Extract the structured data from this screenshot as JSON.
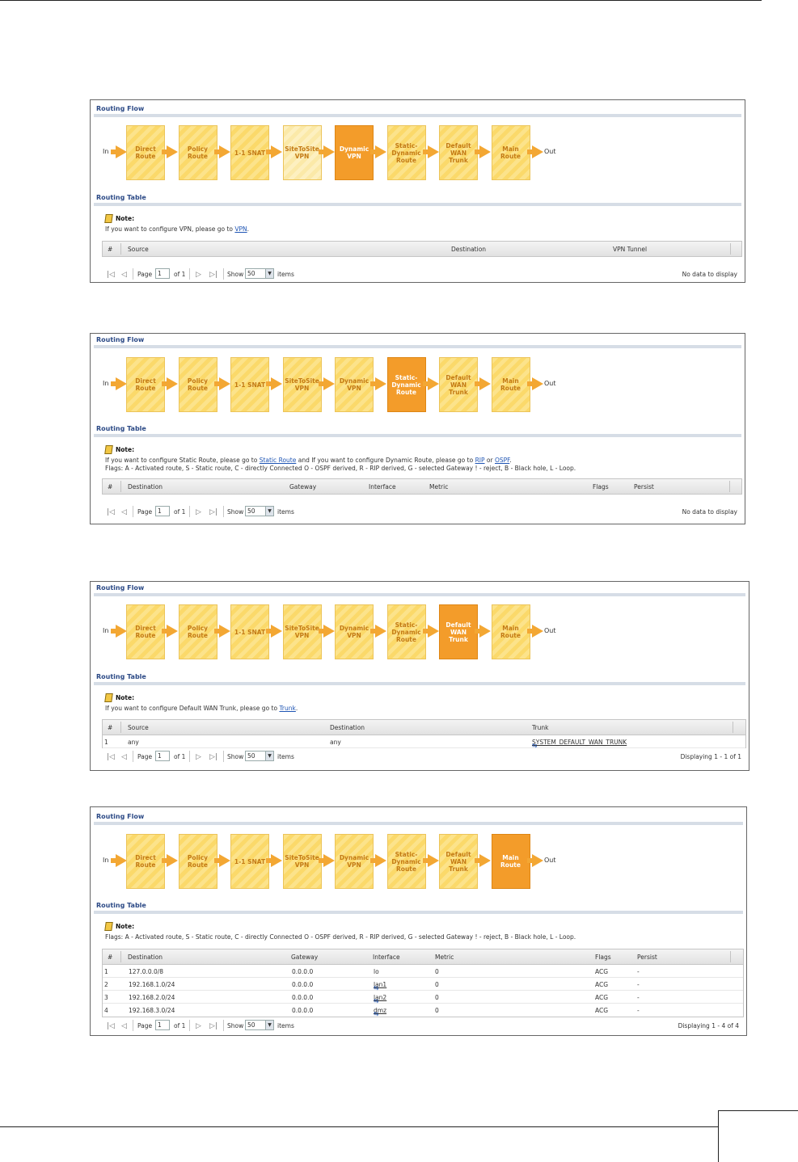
{
  "flow": {
    "title": "Routing Flow",
    "in_label": "In",
    "out_label": "Out",
    "steps": [
      "Direct\nRoute",
      "Policy\nRoute",
      "1-1 SNAT",
      "SiteToSite\nVPN",
      "Dynamic\nVPN",
      "Static-\nDynamic\nRoute",
      "Default\nWAN\nTrunk",
      "Main\nRoute"
    ]
  },
  "table_title": "Routing Table",
  "note_label": "Note:",
  "screens": [
    {
      "active_step": 4,
      "note": {
        "before": "If you want to configure VPN, please go to ",
        "link": "VPN",
        "after": "."
      },
      "columns": [
        "#",
        "Source",
        "Destination",
        "VPN Tunnel"
      ],
      "rows": [],
      "pager": {
        "page_label": "Page",
        "page": "1",
        "of": "of 1",
        "show_label": "Show",
        "show": "50",
        "items": "items",
        "status": "No data to display"
      }
    },
    {
      "active_step": 5,
      "note": {
        "before": "If you want to configure Static Route, please go to ",
        "link": "Static Route",
        "mid": " and If you want to configure Dynamic Route, please go to ",
        "link2": "RIP",
        "mid2": " or ",
        "link3": "OSPF",
        "after": "."
      },
      "flags": "Flags: A - Activated route, S - Static route, C - directly Connected O - OSPF derived, R - RIP derived, G - selected Gateway ! - reject, B - Black hole, L - Loop.",
      "columns": [
        "#",
        "Destination",
        "Gateway",
        "Interface",
        "Metric",
        "Flags",
        "Persist"
      ],
      "rows": [],
      "pager": {
        "page_label": "Page",
        "page": "1",
        "of": "of 1",
        "show_label": "Show",
        "show": "50",
        "items": "items",
        "status": "No data to display"
      }
    },
    {
      "active_step": 6,
      "note": {
        "before": "If you want to configure Default WAN Trunk, please go to ",
        "link": "Trunk",
        "after": "."
      },
      "columns": [
        "#",
        "Source",
        "Destination",
        "Trunk"
      ],
      "rows": [
        {
          "num": "1",
          "source": "any",
          "destination": "any",
          "trunk": "SYSTEM_DEFAULT_WAN_TRUNK"
        }
      ],
      "pager": {
        "page_label": "Page",
        "page": "1",
        "of": "of 1",
        "show_label": "Show",
        "show": "50",
        "items": "items",
        "status": "Displaying 1 - 1 of 1"
      }
    },
    {
      "active_step": 7,
      "flags": "Flags: A - Activated route, S - Static route, C - directly Connected O - OSPF derived, R - RIP derived, G - selected Gateway ! - reject, B - Black hole, L - Loop.",
      "columns": [
        "#",
        "Destination",
        "Gateway",
        "Interface",
        "Metric",
        "Flags",
        "Persist"
      ],
      "rows": [
        {
          "num": "1",
          "destination": "127.0.0.0/8",
          "gateway": "0.0.0.0",
          "interface": "lo",
          "metric": "0",
          "flags": "ACG",
          "persist": "-"
        },
        {
          "num": "2",
          "destination": "192.168.1.0/24",
          "gateway": "0.0.0.0",
          "interface": "lan1",
          "metric": "0",
          "flags": "ACG",
          "persist": "-"
        },
        {
          "num": "3",
          "destination": "192.168.2.0/24",
          "gateway": "0.0.0.0",
          "interface": "lan2",
          "metric": "0",
          "flags": "ACG",
          "persist": "-"
        },
        {
          "num": "4",
          "destination": "192.168.3.0/24",
          "gateway": "0.0.0.0",
          "interface": "dmz",
          "metric": "0",
          "flags": "ACG",
          "persist": "-"
        }
      ],
      "pager": {
        "page_label": "Page",
        "page": "1",
        "of": "of 1",
        "show_label": "Show",
        "show": "50",
        "items": "items",
        "status": "Displaying 1 - 4 of 4"
      }
    }
  ],
  "colors": {
    "active_step": "#f39c2a",
    "step": "#fce38b",
    "arrow": "#f3a733",
    "title": "#2c4a86",
    "link": "#1f55b4"
  }
}
